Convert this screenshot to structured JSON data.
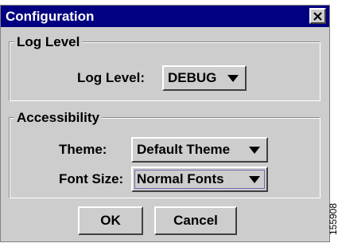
{
  "window": {
    "title": "Configuration",
    "close_glyph": "✕"
  },
  "log_level_group": {
    "legend": "Log Level",
    "label": "Log Level:",
    "selected": "DEBUG"
  },
  "accessibility_group": {
    "legend": "Accessibility",
    "theme_label": "Theme:",
    "theme_selected": "Default Theme",
    "font_size_label": "Font Size:",
    "font_size_selected": "Normal Fonts"
  },
  "buttons": {
    "ok": "OK",
    "cancel": "Cancel"
  },
  "figure_id": "155908",
  "colors": {
    "titlebar": "#000080",
    "dialog_bg": "#cdcdcd"
  }
}
